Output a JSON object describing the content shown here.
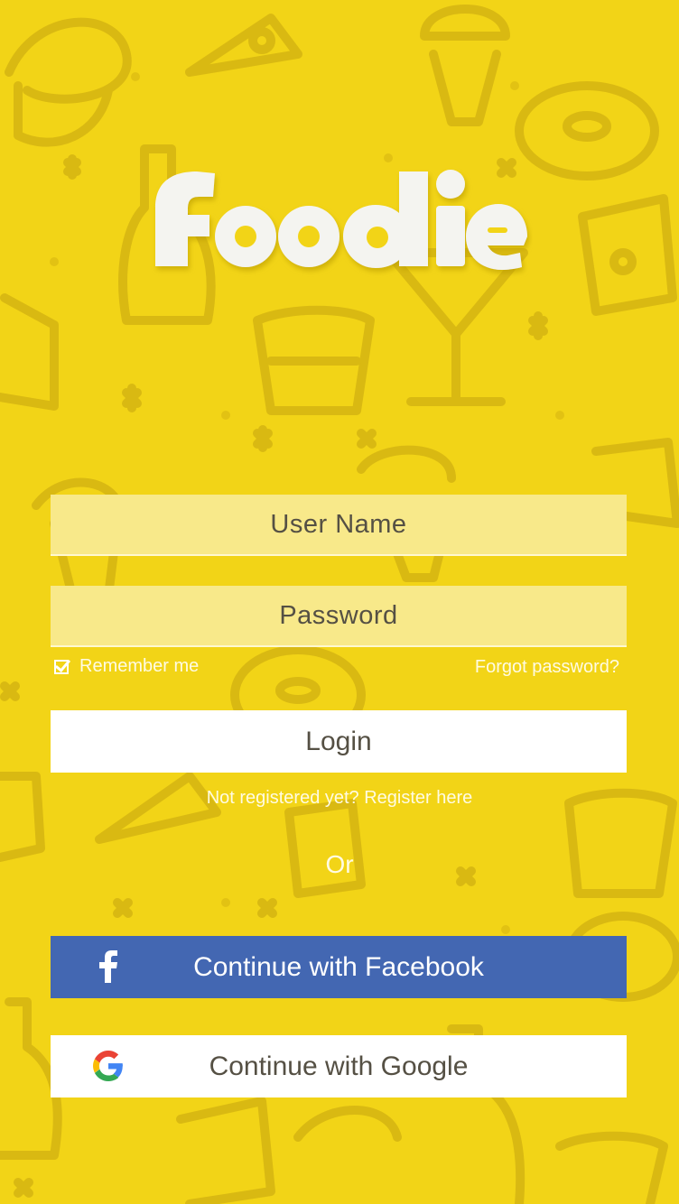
{
  "app": {
    "logo_text": "foodie"
  },
  "login_form": {
    "username_placeholder": "User Name",
    "password_placeholder": "Password",
    "remember_label": "Remember me",
    "remember_checked": true,
    "forgot_label": "Forgot password?",
    "login_label": "Login",
    "register_label": "Not registered yet? Register here",
    "or_label": "Or"
  },
  "social": {
    "facebook_label": "Continue with Facebook",
    "google_label": "Continue with Google"
  },
  "colors": {
    "background": "#f2d417",
    "field": "#f8e98a",
    "facebook": "#4367b2",
    "text": "#555044"
  },
  "icons": [
    "facebook-icon",
    "google-icon",
    "checkbox-icon"
  ]
}
